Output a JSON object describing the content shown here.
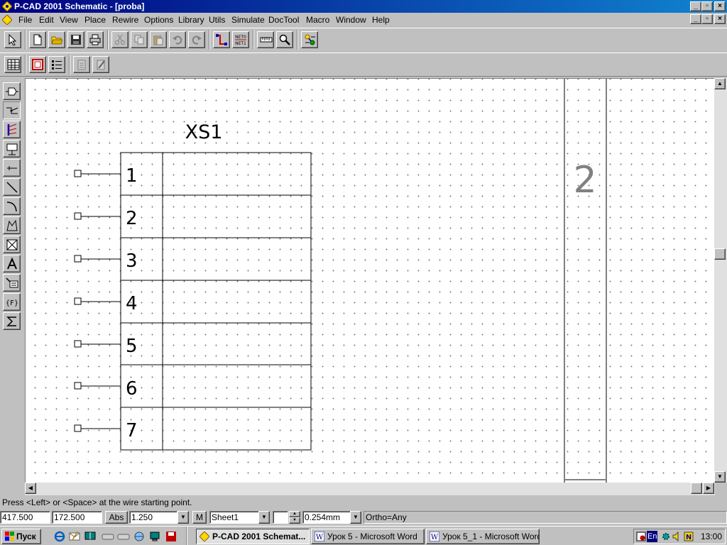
{
  "window": {
    "title": "P-CAD 2001 Schematic - [proba]"
  },
  "menu": [
    "File",
    "Edit",
    "View",
    "Place",
    "Rewire",
    "Options",
    "Library",
    "Utils",
    "Simulate",
    "DocTool",
    "Macro",
    "Window",
    "Help"
  ],
  "toolbar": {
    "net_button_top": "NET0",
    "net_button_bottom": "NET1"
  },
  "schematic": {
    "ref_designator": "XS1",
    "pins": [
      "1",
      "2",
      "3",
      "4",
      "5",
      "6",
      "7"
    ],
    "zone_label": "2"
  },
  "status": {
    "prompt": "Press <Left> or <Space> at the wire starting point.",
    "x_coord": "417.500",
    "y_coord": "172.500",
    "abs_label": "Abs",
    "zoom": "1.250",
    "m_label": "M",
    "sheet": "Sheet1",
    "line_width": "0.254mm",
    "ortho": "Ortho=Any"
  },
  "taskbar": {
    "start": "Пуск",
    "tasks": [
      "P-CAD 2001 Schemat...",
      "Урок 5 - Microsoft Word",
      "Урок 5_1 - Microsoft Word"
    ],
    "lang": "En",
    "clock": "13:00"
  },
  "colors": {
    "titlebar_start": "#000080",
    "titlebar_end": "#1084d0",
    "chrome": "#c0c0c0",
    "canvas": "#ffffff"
  }
}
